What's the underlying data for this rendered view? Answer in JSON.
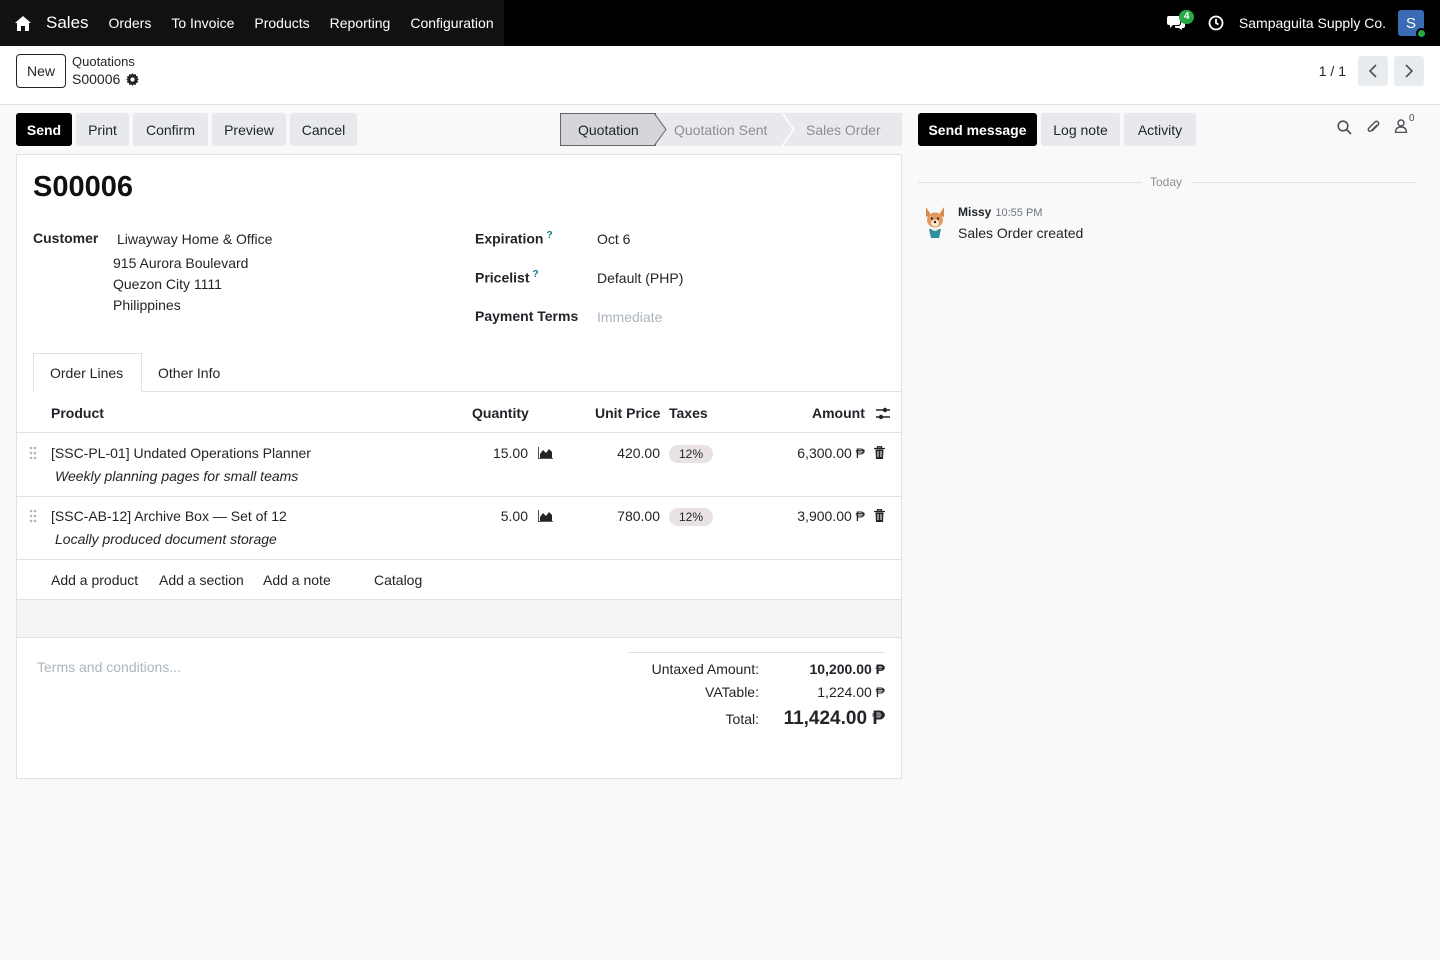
{
  "navbar": {
    "app_name": "Sales",
    "menu": [
      "Orders",
      "To Invoice",
      "Products",
      "Reporting",
      "Configuration"
    ],
    "message_count": "4",
    "company": "Sampaguita Supply Co.",
    "avatar_letter": "S"
  },
  "control": {
    "new_label": "New",
    "breadcrumb_parent": "Quotations",
    "breadcrumb_current": "S00006",
    "pager": "1 / 1"
  },
  "statusbar": {
    "buttons": [
      "Send",
      "Print",
      "Confirm",
      "Preview",
      "Cancel"
    ],
    "stages": [
      "Quotation",
      "Quotation Sent",
      "Sales Order"
    ],
    "active_stage": "Quotation"
  },
  "form": {
    "name": "S00006",
    "customer_label": "Customer",
    "customer_name": "Liwayway Home & Office",
    "address": [
      "915 Aurora Boulevard",
      "Quezon City 1111",
      "Philippines"
    ],
    "expiration_label": "Expiration",
    "expiration_value": "Oct 6",
    "pricelist_label": "Pricelist",
    "pricelist_value": "Default (PHP)",
    "payment_terms_label": "Payment Terms",
    "payment_terms_placeholder": "Immediate",
    "help_mark": "?"
  },
  "tabs": [
    "Order Lines",
    "Other Info"
  ],
  "table": {
    "headers": [
      "Product",
      "Quantity",
      "Unit Price",
      "Taxes",
      "Amount"
    ],
    "rows": [
      {
        "product": "[SSC-PL-01] Undated Operations Planner",
        "description": "Weekly planning pages for small teams",
        "quantity": "15.00",
        "unit_price": "420.00",
        "tax": "12%",
        "amount": "6,300.00 ₱"
      },
      {
        "product": "[SSC-AB-12] Archive Box — Set of 12",
        "description": "Locally produced document storage",
        "quantity": "5.00",
        "unit_price": "780.00",
        "tax": "12%",
        "amount": "3,900.00 ₱"
      }
    ],
    "add_links": [
      "Add a product",
      "Add a section",
      "Add a note",
      "Catalog"
    ]
  },
  "footer": {
    "terms_placeholder": "Terms and conditions...",
    "untaxed_label": "Untaxed Amount:",
    "untaxed_value": "10,200.00 ₱",
    "vat_label": "VATable:",
    "vat_value": "1,224.00 ₱",
    "total_label": "Total:",
    "total_value": "11,424.00 ₱"
  },
  "chatter": {
    "buttons": [
      "Send message",
      "Log note",
      "Activity"
    ],
    "follower_count": "0",
    "today": "Today",
    "message": {
      "author": "Missy",
      "time": "10:55 PM",
      "body": "Sales Order created"
    }
  },
  "colors": {
    "accent": "#017e84",
    "badge_green": "#28a745",
    "avatar_blue": "#3a6cb5"
  }
}
